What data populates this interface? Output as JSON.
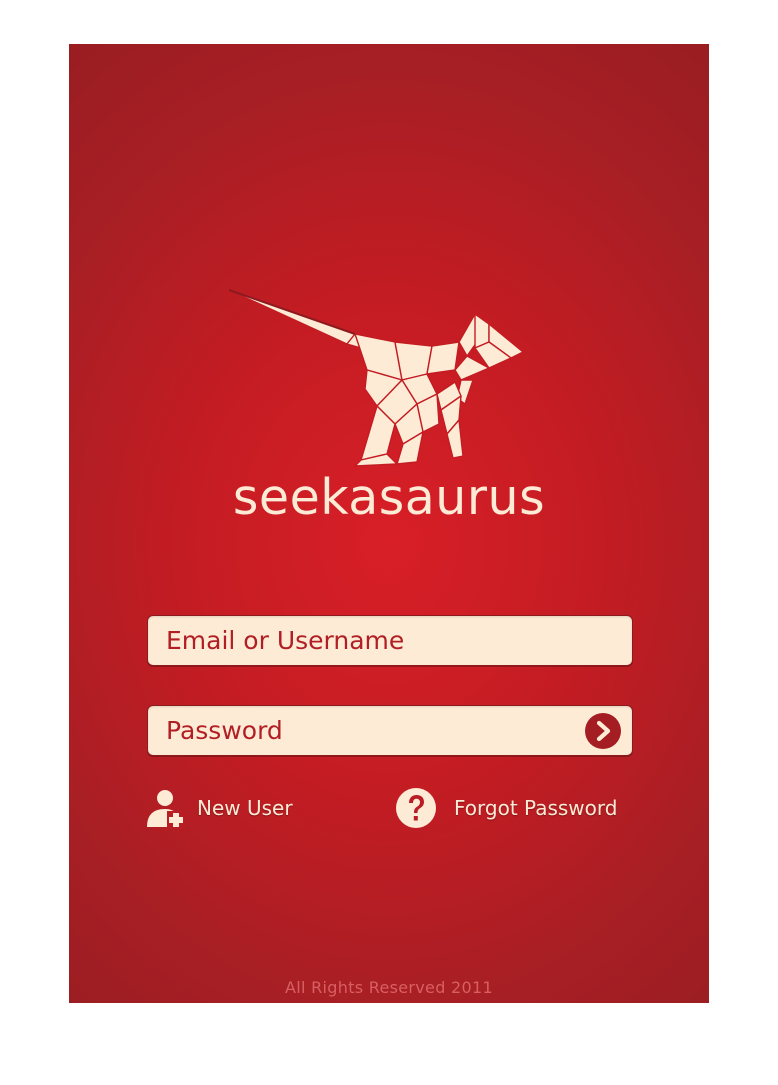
{
  "app": {
    "brand_name": "seekasaurus"
  },
  "login": {
    "email_placeholder": "Email or Username",
    "password_placeholder": "Password",
    "submit_icon": "arrow-right-icon"
  },
  "links": {
    "new_user_label": "New User",
    "new_user_icon": "add-user-icon",
    "forgot_password_label": "Forgot Password",
    "forgot_password_icon": "question-icon"
  },
  "footer": {
    "copyright": "All Rights Reserved 2011"
  },
  "colors": {
    "background": "#c41c23",
    "field_fill": "#fdebd6",
    "field_text": "#b11f25",
    "accent_dark": "#a41d22",
    "footer_text": "#d85f62"
  }
}
